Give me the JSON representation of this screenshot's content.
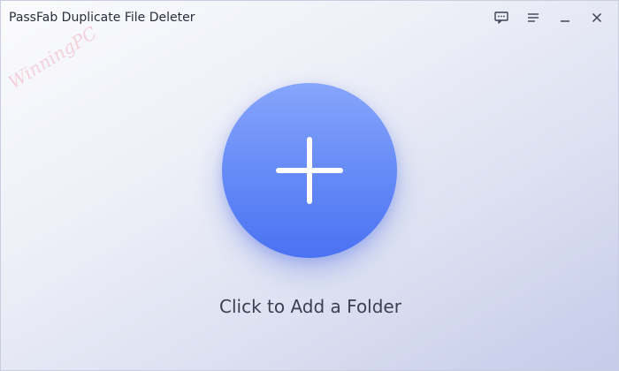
{
  "window": {
    "title": "PassFab Duplicate File Deleter"
  },
  "controls": {
    "feedback_icon": "feedback-icon",
    "menu_icon": "menu-icon",
    "minimize_icon": "minimize-icon",
    "close_icon": "close-icon"
  },
  "watermark": {
    "text": "WinningPC"
  },
  "main": {
    "add_icon": "plus-icon",
    "add_label": "Click to Add a Folder"
  },
  "colors": {
    "accent": "#5b82f5",
    "text": "#2a2f3d",
    "icon": "#3b4257"
  }
}
